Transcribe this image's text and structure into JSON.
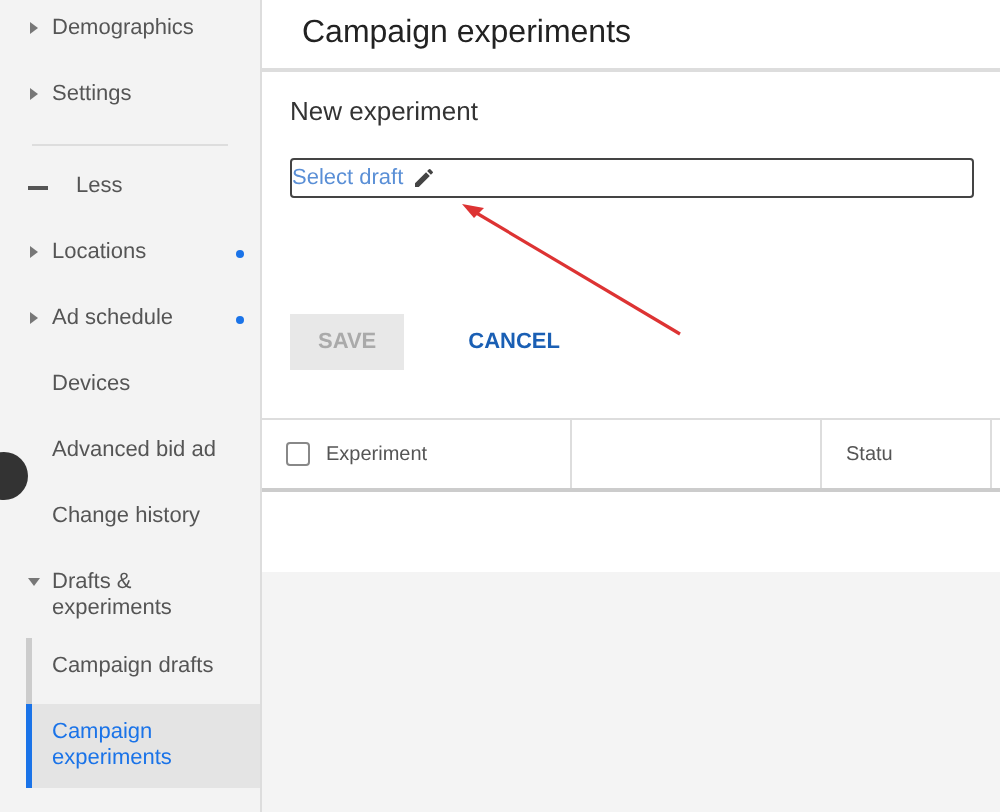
{
  "sidebar": {
    "items": [
      {
        "label": "Demographics",
        "kind": "expandable",
        "dot": false,
        "expanded": false
      },
      {
        "label": "Settings",
        "kind": "expandable",
        "dot": false,
        "expanded": false
      },
      {
        "label": "Less",
        "kind": "toggle"
      },
      {
        "label": "Locations",
        "kind": "expandable",
        "dot": true,
        "expanded": false
      },
      {
        "label": "Ad schedule",
        "kind": "expandable",
        "dot": true,
        "expanded": false
      },
      {
        "label": "Devices",
        "kind": "plain",
        "dot": false
      },
      {
        "label": "Advanced bid ad",
        "kind": "plain",
        "dot": false
      },
      {
        "label": "Change history",
        "kind": "plain",
        "dot": false
      },
      {
        "label": "Drafts & experiments",
        "kind": "expandable",
        "dot": false,
        "expanded": true,
        "children": [
          {
            "label": "Campaign drafts",
            "selected": false
          },
          {
            "label": "Campaign experiments",
            "selected": true
          }
        ]
      }
    ]
  },
  "page": {
    "title": "Campaign experiments",
    "section": "New experiment",
    "draft_field": {
      "placeholder": "Select draft"
    },
    "buttons": [
      {
        "label": "SAVE",
        "disabled": true
      },
      {
        "label": "CANCEL",
        "disabled": false
      }
    ],
    "table": {
      "select_all": {
        "checked": false
      },
      "columns": [
        "Experiment",
        "",
        "Statu"
      ]
    }
  }
}
